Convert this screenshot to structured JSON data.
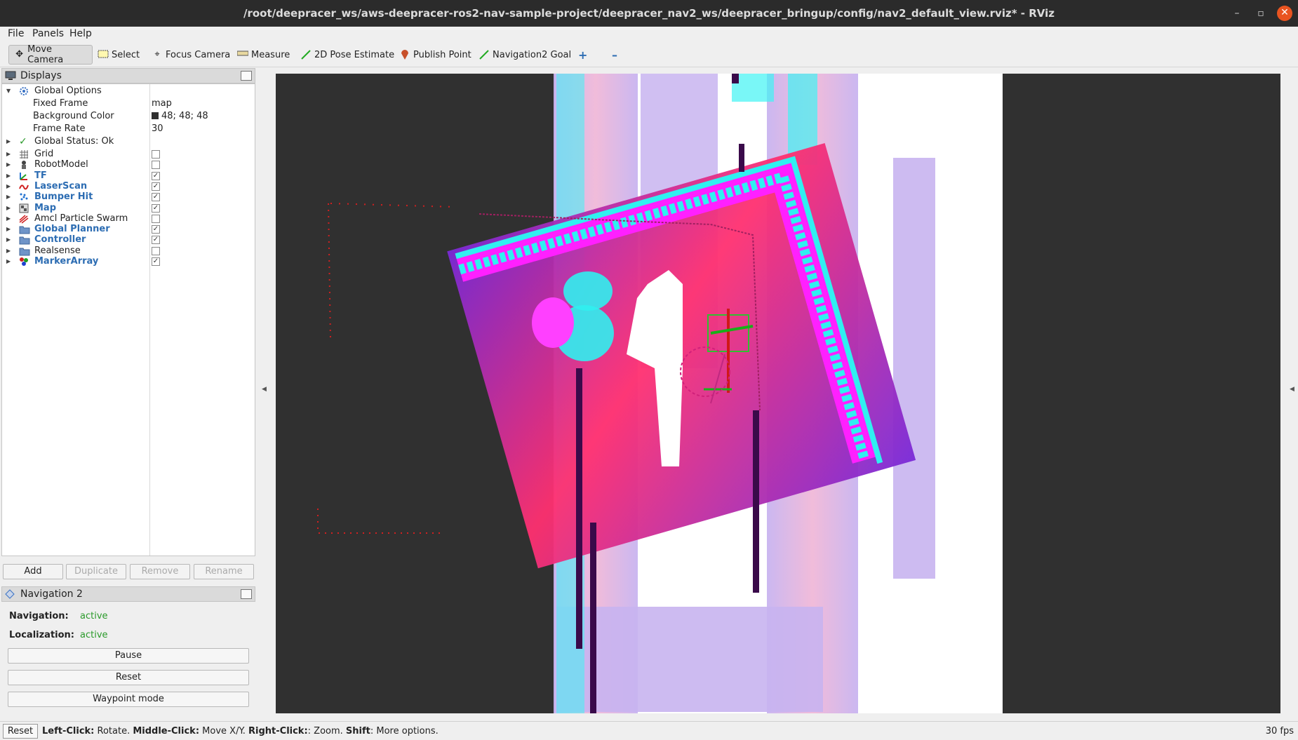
{
  "window": {
    "title": "/root/deepracer_ws/aws-deepracer-ros2-nav-sample-project/deepracer_nav2_ws/deepracer_bringup/config/nav2_default_view.rviz* - RViz",
    "minimize": "–",
    "maximize": "▫",
    "close": "✕"
  },
  "menu": {
    "file": "File",
    "panels": "Panels",
    "help": "Help"
  },
  "toolbar": {
    "move_camera": "Move Camera",
    "select": "Select",
    "focus_camera": "Focus Camera",
    "measure": "Measure",
    "pose_estimate": "2D Pose Estimate",
    "publish_point": "Publish Point",
    "nav_goal": "Navigation2 Goal",
    "add_tool": "+",
    "remove_tool": "–"
  },
  "displays": {
    "header": "Displays",
    "global_options": {
      "label": "Global Options",
      "fixed_frame_label": "Fixed Frame",
      "fixed_frame_value": "map",
      "background_color_label": "Background Color",
      "background_color_value": "48; 48; 48",
      "background_color_hex": "#303030",
      "frame_rate_label": "Frame Rate",
      "frame_rate_value": "30"
    },
    "global_status": "Global Status: Ok",
    "items": [
      {
        "label": "Grid",
        "checked": false,
        "highlight": false,
        "icon": "grid-icon"
      },
      {
        "label": "RobotModel",
        "checked": false,
        "highlight": false,
        "icon": "robot-icon"
      },
      {
        "label": "TF",
        "checked": true,
        "highlight": true,
        "icon": "tf-icon"
      },
      {
        "label": "LaserScan",
        "checked": true,
        "highlight": true,
        "icon": "laserscan-icon"
      },
      {
        "label": "Bumper Hit",
        "checked": true,
        "highlight": true,
        "icon": "pointcloud-icon"
      },
      {
        "label": "Map",
        "checked": true,
        "highlight": true,
        "icon": "map-icon"
      },
      {
        "label": "Amcl Particle Swarm",
        "checked": false,
        "highlight": false,
        "icon": "posearray-icon"
      },
      {
        "label": "Global Planner",
        "checked": true,
        "highlight": true,
        "icon": "folder-icon"
      },
      {
        "label": "Controller",
        "checked": true,
        "highlight": true,
        "icon": "folder-icon"
      },
      {
        "label": "Realsense",
        "checked": false,
        "highlight": false,
        "icon": "folder-icon"
      },
      {
        "label": "MarkerArray",
        "checked": true,
        "highlight": true,
        "icon": "marker-icon"
      }
    ],
    "buttons": {
      "add": "Add",
      "duplicate": "Duplicate",
      "remove": "Remove",
      "rename": "Rename"
    }
  },
  "navigation_panel": {
    "header": "Navigation 2",
    "navigation_label": "Navigation:",
    "navigation_status": "active",
    "localization_label": "Localization:",
    "localization_status": "active",
    "pause": "Pause",
    "reset": "Reset",
    "waypoint_mode": "Waypoint mode"
  },
  "statusbar": {
    "reset": "Reset",
    "hint_left_click": "Left-Click:",
    "hint_left_action": " Rotate. ",
    "hint_middle_click": "Middle-Click:",
    "hint_middle_action": " Move X/Y. ",
    "hint_right_click": "Right-Click:",
    "hint_right_action": ": Zoom. ",
    "hint_shift": "Shift",
    "hint_shift_action": ": More options.",
    "fps": "30 fps"
  },
  "colors": {
    "highlight_text": "#2d6db3",
    "status_active": "#2a9a2a",
    "costmap_cyan": "#20f0f0",
    "costmap_magenta": "#ff20ff",
    "costmap_lavender": "#c8b4f0"
  }
}
